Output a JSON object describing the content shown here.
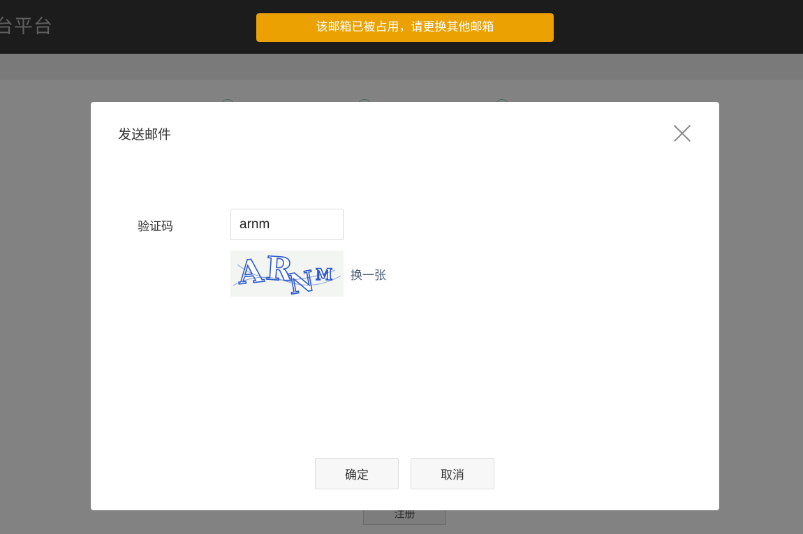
{
  "header": {
    "brand_fragment": "台平台"
  },
  "toast": {
    "message": "该邮箱已被占用，请更换其他邮箱",
    "color": "#eba102"
  },
  "background": {
    "register_button_label": "注册"
  },
  "modal": {
    "title": "发送邮件",
    "close_icon": "close-icon",
    "captcha_label": "验证码",
    "captcha_value": "arnm",
    "captcha_image_text": "ARNM",
    "refresh_label": "换一张",
    "confirm_label": "确定",
    "cancel_label": "取消"
  }
}
